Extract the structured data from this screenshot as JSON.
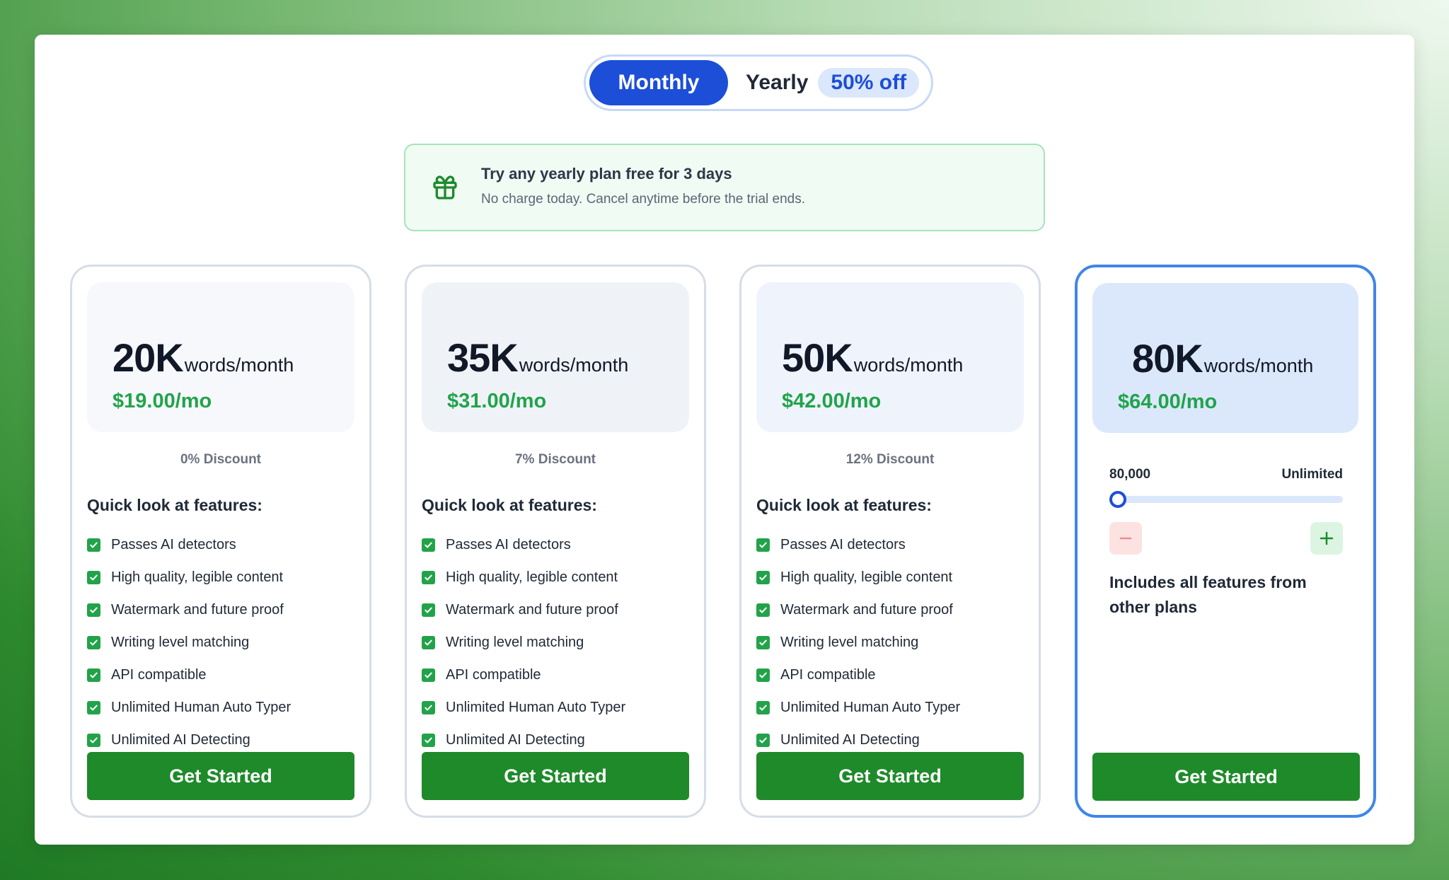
{
  "billing_toggle": {
    "monthly_label": "Monthly",
    "yearly_label": "Yearly",
    "yearly_badge": "50% off",
    "selected": "Monthly"
  },
  "trial_banner": {
    "icon": "gift-icon",
    "title": "Try any yearly plan free for 3 days",
    "subtitle": "No charge today. Cancel anytime before the trial ends."
  },
  "features_title": "Quick look at features:",
  "features": [
    "Passes AI detectors",
    "High quality, legible content",
    "Watermark and future proof",
    "Writing level matching",
    "API compatible",
    "Unlimited Human Auto Typer",
    "Unlimited AI Detecting"
  ],
  "plans": [
    {
      "amount": "20K",
      "unit": "words/month",
      "price": "$19.00/mo",
      "discount": "0% Discount",
      "cta": "Get Started"
    },
    {
      "amount": "35K",
      "unit": "words/month",
      "price": "$31.00/mo",
      "discount": "7% Discount",
      "cta": "Get Started"
    },
    {
      "amount": "50K",
      "unit": "words/month",
      "price": "$42.00/mo",
      "discount": "12% Discount",
      "cta": "Get Started"
    }
  ],
  "custom_plan": {
    "amount": "80K",
    "unit": "words/month",
    "price": "$64.00/mo",
    "slider_min_label": "80,000",
    "slider_max_label": "Unlimited",
    "slider_value_fraction": 0.0,
    "includes": "Includes all features from other plans",
    "cta": "Get Started"
  },
  "colors": {
    "accent_blue": "#1d4ed8",
    "price_green": "#22a34a",
    "cta_green": "#1e8a2a",
    "selected_border": "#3f86e8"
  }
}
